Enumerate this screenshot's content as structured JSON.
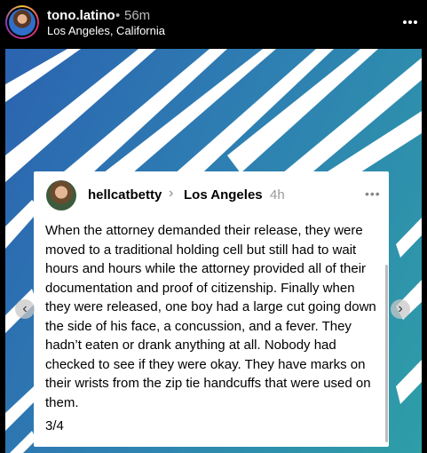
{
  "header": {
    "username": "tono.latino",
    "separator": "•",
    "time": "56m",
    "location": "Los Angeles, California",
    "more_icon": "more-horizontal-icon"
  },
  "card": {
    "username": "hellcatbetty",
    "chevron": "›",
    "location": "Los Angeles",
    "time": "4h",
    "more": "•••",
    "text": "When the attorney demanded their release, they were moved to a traditional holding cell but still had to wait hours and hours while the attorney provided all of their documentation and proof of citizenship. Finally when they were released, one boy had a large cut going down the side of his face, a concussion, and a fever. They hadn’t eaten or drank anything at all. Nobody had checked to see if they were okay. They have marks on their wrists from the zip tie handcuffs that were used on them.",
    "page": "3/4"
  },
  "nav": {
    "prev": "‹",
    "next": "›"
  },
  "colors": {
    "background": "#000000",
    "media_gradient_start": "#2b63b0",
    "media_gradient_end": "#2e9ea7"
  }
}
